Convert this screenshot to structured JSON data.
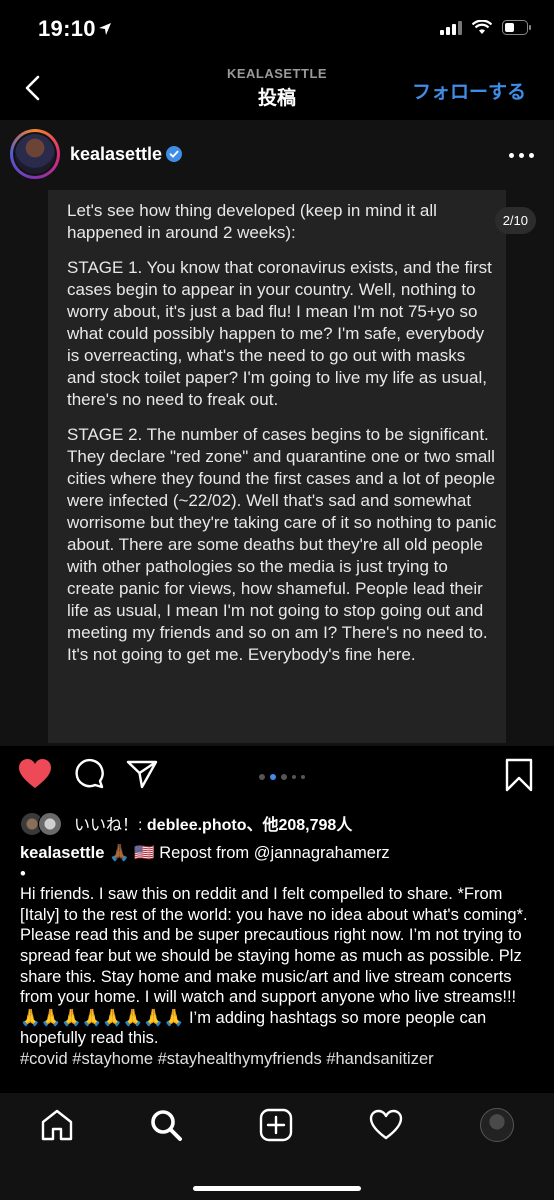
{
  "status": {
    "time": "19:10"
  },
  "nav": {
    "username": "KEALASETTLE",
    "subtitle": "投稿",
    "follow": "フォローする"
  },
  "post": {
    "username": "kealasettle",
    "counter": "2/10",
    "paragraphs": [
      "Let's see how thing developed (keep in mind it all happened in around 2 weeks):",
      "STAGE 1. You know that coronavirus exists, and the first cases begin to appear in your country. Well, nothing to worry about, it's just a bad flu! I mean I'm not 75+yo so what could possibly happen to me? I'm safe, everybody is overreacting, what's the need to go out with masks and stock toilet paper? I'm going to live my life as usual, there's no need to freak out.",
      "STAGE 2. The number of cases begins to be significant. They declare \"red zone\" and quarantine one or two small cities where they found the first cases and a lot of people were infected (~22/02). Well that's sad and somewhat worrisome but they're taking care of it so nothing to panic about. There are some deaths but they're all old people with other pathologies so the media is just trying to create panic for views, how shameful. People lead their life as usual, I mean I'm not going to stop going out and meeting my friends and so on am I? There's no need to. It's not going to get me. Everybody's fine here."
    ]
  },
  "likes": {
    "prefix": "いいね！: ",
    "user": "deblee.photo",
    "sep": "、",
    "others": "他208,798人"
  },
  "caption": {
    "username": "kealasettle",
    "emoji": " 🙏🏾 🇺🇸 ",
    "repost": "Repost from @jannagrahamerz",
    "bullet": "•",
    "body": "Hi friends. I saw this on reddit and I felt compelled to share. *From [Italy] to the rest of the world: you have no idea about what's coming*. Please read this and be super precautious right now. I’m not trying to spread fear but we should be staying home as much as possible. Plz share this. Stay home and make music/art and live stream concerts from your home. I will watch and support anyone who live streams!!! 🙏🙏🙏🙏🙏🙏🙏🙏 I’m adding hashtags so more people can hopefully read this.",
    "hashtags": "#covid #stayhome #stayhealthymyfriends #handsanitizer"
  },
  "colors": {
    "accent": "#3f8ee6",
    "like": "#ed4956",
    "background": "#000000",
    "surface": "#121212"
  }
}
